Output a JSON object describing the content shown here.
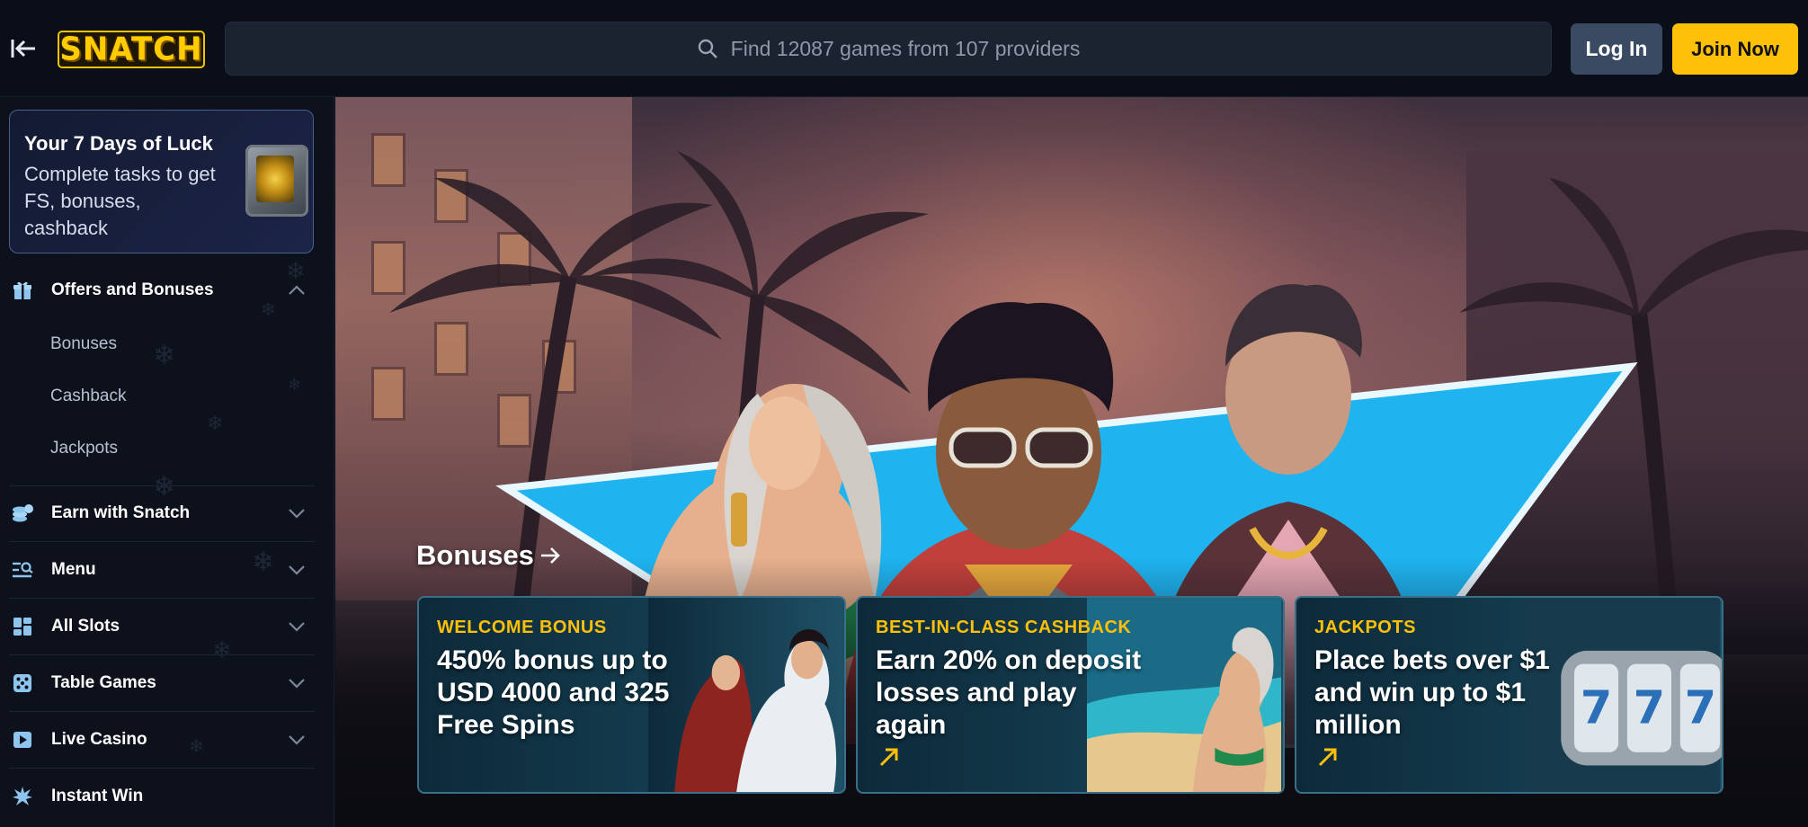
{
  "header": {
    "collapse_icon": "collapse-sidebar-icon",
    "logo_text": "SNATCH",
    "search_placeholder": "Find 12087 games from 107 providers",
    "login_label": "Log In",
    "join_label": "Join Now"
  },
  "sidebar": {
    "luck_card": {
      "title": "Your 7 Days of Luck",
      "description": "Complete tasks to get FS, bonuses, cashback",
      "icon": "safe-icon"
    },
    "offers": {
      "label": "Offers and Bonuses",
      "icon": "gift-icon",
      "expanded": true,
      "sub_items": [
        "Bonuses",
        "Cashback",
        "Jackpots"
      ]
    },
    "items": [
      {
        "label": "Earn with Snatch",
        "icon": "coins-icon"
      },
      {
        "label": "Menu",
        "icon": "menu-search-icon"
      },
      {
        "label": "All Slots",
        "icon": "grid-icon"
      },
      {
        "label": "Table Games",
        "icon": "dice-icon"
      },
      {
        "label": "Live Casino",
        "icon": "play-icon"
      },
      {
        "label": "Instant Win",
        "icon": "burst-icon"
      }
    ]
  },
  "hero": {
    "section_link": "Bonuses",
    "cards": [
      {
        "kicker": "WELCOME BONUS",
        "headline": "450% bonus up to USD 4000 and 325 Free Spins"
      },
      {
        "kicker": "BEST-IN-CLASS CASHBACK",
        "headline": "Earn 20% on deposit losses and play again"
      },
      {
        "kicker": "JACKPOTS",
        "headline": "Place bets over $1 and win up to $1 million"
      }
    ]
  },
  "colors": {
    "accent_yellow": "#ffc107",
    "login_bg": "#3a4a62",
    "sidebar_bg": "#0d111c",
    "triangle_blue": "#1fb4f0"
  }
}
